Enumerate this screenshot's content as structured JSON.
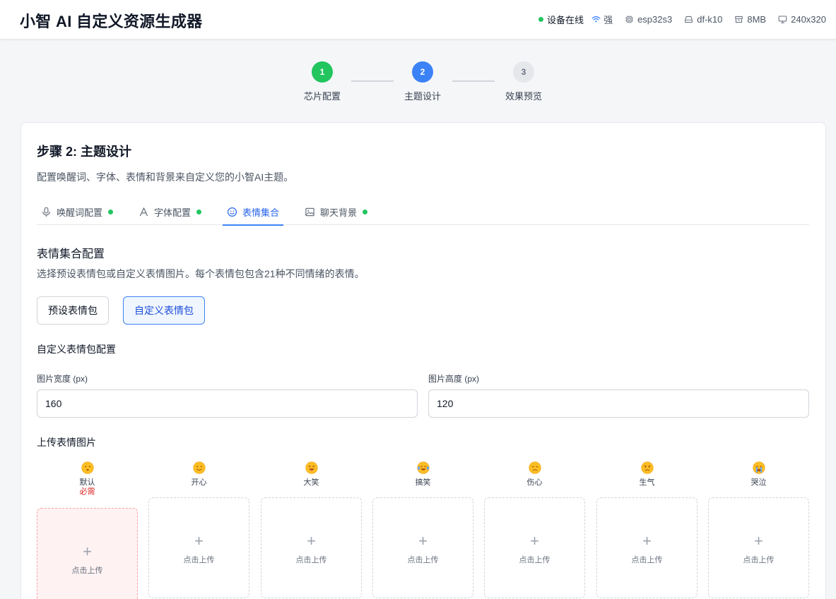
{
  "header": {
    "title": "小智 AI 自定义资源生成器",
    "status": {
      "online": "设备在线",
      "signal": "强",
      "chip": "esp32s3",
      "board": "df-k10",
      "flash": "8MB",
      "resolution": "240x320"
    }
  },
  "stepper": [
    {
      "number": "1",
      "label": "芯片配置",
      "state": "done"
    },
    {
      "number": "2",
      "label": "主题设计",
      "state": "active"
    },
    {
      "number": "3",
      "label": "效果预览",
      "state": "pending"
    }
  ],
  "card": {
    "title": "步骤 2: 主题设计",
    "description": "配置唤醒词、字体、表情和背景来自定义您的小智AI主题。"
  },
  "tabs": [
    {
      "label": "唤醒词配置",
      "icon": "microphone-icon",
      "complete": true
    },
    {
      "label": "字体配置",
      "icon": "font-icon",
      "complete": true
    },
    {
      "label": "表情集合",
      "icon": "smile-icon",
      "complete": false,
      "active": true
    },
    {
      "label": "聊天背景",
      "icon": "image-icon",
      "complete": true
    }
  ],
  "emoji_section": {
    "title": "表情集合配置",
    "description": "选择预设表情包或自定义表情图片。每个表情包包含21种不同情绪的表情。",
    "preset_button": "预设表情包",
    "custom_button": "自定义表情包",
    "custom_title": "自定义表情包配置",
    "width_label": "图片宽度 (px)",
    "width_value": "160",
    "height_label": "图片高度 (px)",
    "height_value": "120",
    "upload_title": "上传表情图片",
    "upload_text": "点击上传",
    "plus": "+",
    "required_text": "必需",
    "emotions": [
      {
        "name": "默认",
        "emoji": "neutral",
        "required": true
      },
      {
        "name": "开心",
        "emoji": "happy",
        "required": false
      },
      {
        "name": "大笑",
        "emoji": "laugh",
        "required": false
      },
      {
        "name": "搞笑",
        "emoji": "tears-of-joy",
        "required": false
      },
      {
        "name": "伤心",
        "emoji": "sad",
        "required": false
      },
      {
        "name": "生气",
        "emoji": "angry",
        "required": false
      },
      {
        "name": "哭泣",
        "emoji": "crying",
        "required": false
      }
    ]
  },
  "colors": {
    "accent": "#3b82f6",
    "success": "#22c55e",
    "danger": "#dc2626",
    "emoji_face": "#fbbf24"
  }
}
